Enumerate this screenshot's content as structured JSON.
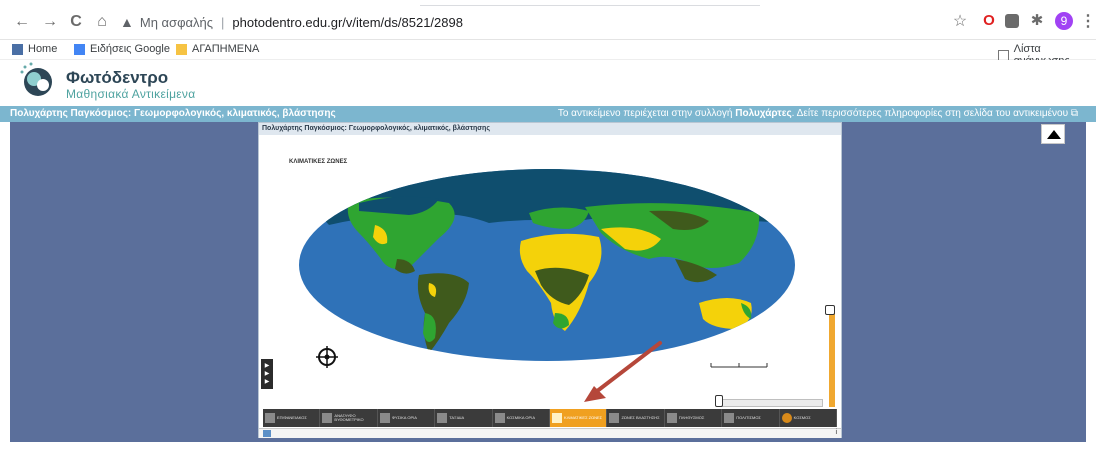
{
  "browser": {
    "address_insecure": "Μη ασφαλής",
    "url": "photodentro.edu.gr/v/item/ds/8521/2898",
    "profile_initial": "9"
  },
  "bookmarks": [
    {
      "label": "Home",
      "icon": "home-bookmark-icon"
    },
    {
      "label": "Ειδήσεις Google",
      "icon": "google-news-icon"
    },
    {
      "label": "ΑΓΑΠΗΜΕΝΑ",
      "icon": "folder-icon"
    }
  ],
  "reading_list": "Λίστα ανάγνωσης",
  "site": {
    "title": "Φωτόδεντρο",
    "subtitle": "Μαθησιακά Αντικείμενα"
  },
  "info_bar": {
    "left": "Πολυχάρτης Παγκόσμιος: Γεωμορφολογικός, κλιματικός, βλάστησης",
    "right_prefix": "Το αντικείμενο περιέχεται στην συλλογή ",
    "right_collection": "Πολυχάρτες",
    "right_suffix": ". Δείτε περισσότερες πληροφορίες στη σελίδα του αντικειμένου"
  },
  "viewer": {
    "title": "Πολυχάρτης Παγκόσμιος: Γεωμορφολογικός, κλιματικός, βλάστησης",
    "map_title": "ΚΛΙΜΑΤΙΚΕΣ ΖΩΝΕΣ",
    "info_icon": "i"
  },
  "toolbar": [
    {
      "label": "ΕΠΙΦΑΝΕΙΑΚΟΣ",
      "icon": "surface-layer-icon",
      "active": false
    },
    {
      "label": "ΑΝΑΓΛΥΦΟ ΒΥΘΟΜΕΤΡΙΚΟ",
      "icon": "relief-layer-icon",
      "active": false
    },
    {
      "label": "ΦΥΣΙΚΑ ΟΡΙΑ",
      "icon": "physical-borders-icon",
      "active": false
    },
    {
      "label": "ΤΑΞΙΔΙΑ",
      "icon": "travels-layer-icon",
      "active": false
    },
    {
      "label": "ΚΟΣΜΙΚΑ ΟΡΙΑ",
      "icon": "world-borders-icon",
      "active": false
    },
    {
      "label": "ΚΛΙΜΑΤΙΚΕΣ ΖΩΝΕΣ",
      "icon": "climate-zones-icon",
      "active": true
    },
    {
      "label": "ΖΩΝΕΣ ΒΛΑΣΤΗΣΗΣ",
      "icon": "vegetation-zones-icon",
      "active": false
    },
    {
      "label": "ΠΛΗΘΥΣΜΟΣ",
      "icon": "population-icon",
      "active": false
    },
    {
      "label": "ΠΟΛΙΤΙΣΜΟΣ",
      "icon": "culture-icon",
      "active": false
    },
    {
      "label": "ΚΟΣΜΟΣ",
      "icon": "globe-icon",
      "active": false
    }
  ],
  "colors": {
    "stage": "#5b6f9b",
    "info_bar": "#7cb6cf",
    "ocean": "#2f72b8",
    "zone_tropical": "#3f5a1c",
    "zone_arid": "#f4d20a",
    "zone_temperate": "#2fa531",
    "zone_cold": "#0f4e6e",
    "highlight": "#f0a020",
    "annotation_arrow": "#b5473a"
  }
}
